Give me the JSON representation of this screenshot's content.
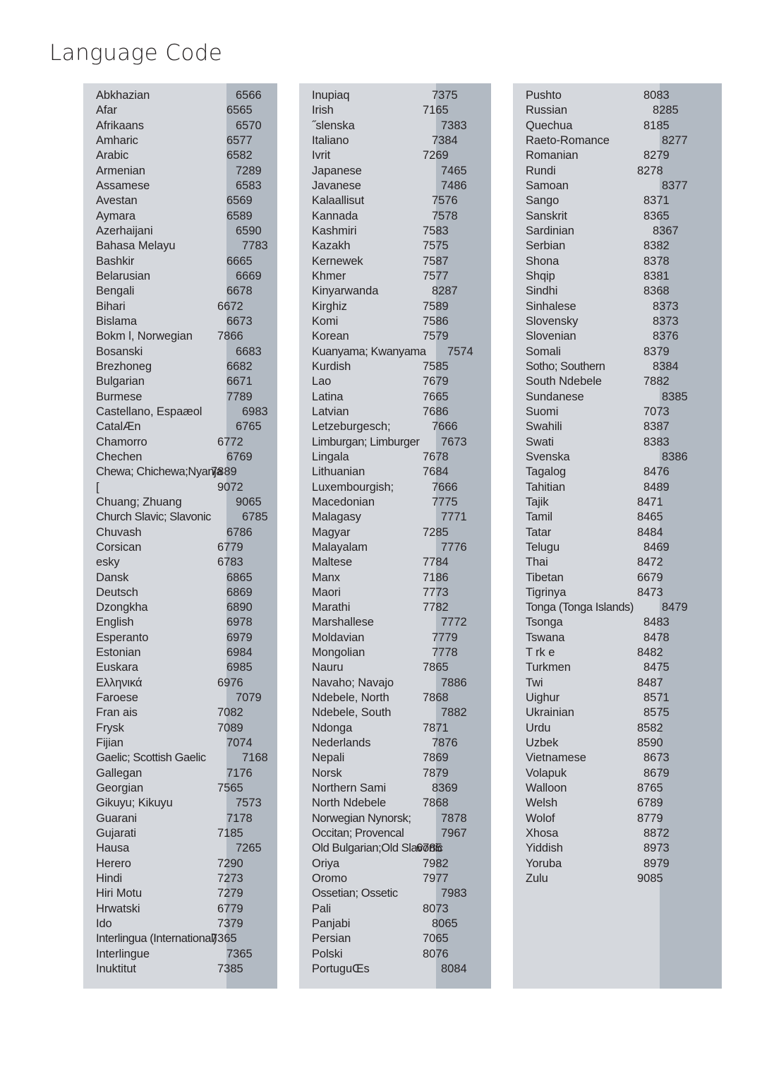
{
  "page": {
    "title": "Language Code"
  },
  "columns": [
    {
      "id": "column-1",
      "rows": [
        {
          "name": "Abkhazian",
          "code": "6566",
          "shift": "r"
        },
        {
          "name": "Afar",
          "code": "6565",
          "shift": ""
        },
        {
          "name": "Afrikaans",
          "code": "6570",
          "shift": "r"
        },
        {
          "name": "Amharic",
          "code": "6577",
          "shift": ""
        },
        {
          "name": "Arabic",
          "code": "6582",
          "shift": ""
        },
        {
          "name": "Armenian",
          "code": "7289",
          "shift": "r"
        },
        {
          "name": "Assamese",
          "code": "6583",
          "shift": "r"
        },
        {
          "name": "Avestan",
          "code": "6569",
          "shift": ""
        },
        {
          "name": "Aymara",
          "code": "6589",
          "shift": ""
        },
        {
          "name": "Azerhaijani",
          "code": "6590",
          "shift": "r"
        },
        {
          "name": "Bahasa Melayu",
          "code": "7783",
          "shift": "r2"
        },
        {
          "name": "Bashkir",
          "code": "6665",
          "shift": ""
        },
        {
          "name": "Belarusian",
          "code": "6669",
          "shift": "r"
        },
        {
          "name": "Bengali",
          "code": "6678",
          "shift": ""
        },
        {
          "name": "Bihari",
          "code": "6672",
          "shift": "l"
        },
        {
          "name": "Bislama",
          "code": "6673",
          "shift": ""
        },
        {
          "name": "Bokm l, Norwegian",
          "code": "7866",
          "shift": "l"
        },
        {
          "name": "Bosanski",
          "code": "6683",
          "shift": "r"
        },
        {
          "name": "Brezhoneg",
          "code": "6682",
          "shift": ""
        },
        {
          "name": "Bulgarian",
          "code": "6671",
          "shift": ""
        },
        {
          "name": "Burmese",
          "code": "7789",
          "shift": ""
        },
        {
          "name": "Castellano, Espaæol",
          "code": "6983",
          "shift": "r2"
        },
        {
          "name": "CatalÆn",
          "code": "6765",
          "shift": "r"
        },
        {
          "name": "Chamorro",
          "code": "6772",
          "shift": "l"
        },
        {
          "name": "Chechen",
          "code": "6769",
          "shift": ""
        },
        {
          "name": "Chewa; Chichewa;Nyanja",
          "code": "7889",
          "shift": "l2",
          "wide": true
        },
        {
          "name": "[",
          "code": "9072",
          "shift": "l"
        },
        {
          "name": "Chuang; Zhuang",
          "code": "9065",
          "shift": "r"
        },
        {
          "name": "Church Slavic; Slavonic",
          "code": "6785",
          "shift": "r2",
          "wide": true
        },
        {
          "name": "Chuvash",
          "code": "6786",
          "shift": ""
        },
        {
          "name": "Corsican",
          "code": "6779",
          "shift": "l"
        },
        {
          "name": " esky",
          "code": "6783",
          "shift": "l"
        },
        {
          "name": "Dansk",
          "code": "6865",
          "shift": ""
        },
        {
          "name": "Deutsch",
          "code": "6869",
          "shift": ""
        },
        {
          "name": "Dzongkha",
          "code": "6890",
          "shift": ""
        },
        {
          "name": "English",
          "code": "6978",
          "shift": ""
        },
        {
          "name": "Esperanto",
          "code": "6979",
          "shift": ""
        },
        {
          "name": "Estonian",
          "code": "6984",
          "shift": ""
        },
        {
          "name": "Euskara",
          "code": "6985",
          "shift": ""
        },
        {
          "name": "Ελληνικά",
          "code": "6976",
          "shift": "l"
        },
        {
          "name": "Faroese",
          "code": "7079",
          "shift": "r"
        },
        {
          "name": "Fran ais",
          "code": "7082",
          "shift": "l"
        },
        {
          "name": "Frysk",
          "code": "7089",
          "shift": "l"
        },
        {
          "name": "Fijian",
          "code": "7074",
          "shift": ""
        },
        {
          "name": "Gaelic; Scottish Gaelic",
          "code": "7168",
          "shift": "r2",
          "wide": true
        },
        {
          "name": "Gallegan",
          "code": "7176",
          "shift": ""
        },
        {
          "name": "Georgian",
          "code": "7565",
          "shift": "l"
        },
        {
          "name": "Gikuyu; Kikuyu",
          "code": "7573",
          "shift": "r"
        },
        {
          "name": "Guarani",
          "code": "7178",
          "shift": ""
        },
        {
          "name": "Gujarati",
          "code": "7185",
          "shift": "l"
        },
        {
          "name": "Hausa",
          "code": "7265",
          "shift": "r"
        },
        {
          "name": "Herero",
          "code": "7290",
          "shift": "l"
        },
        {
          "name": "Hindi",
          "code": "7273",
          "shift": "l"
        },
        {
          "name": "Hiri Motu",
          "code": "7279",
          "shift": "l"
        },
        {
          "name": "Hrwatski",
          "code": "6779",
          "shift": "l"
        },
        {
          "name": "Ido",
          "code": "7379",
          "shift": "l"
        },
        {
          "name": "Interlingua (International)",
          "code": "7365",
          "shift": "l2",
          "wide": true
        },
        {
          "name": "Interlingue",
          "code": "7365",
          "shift": ""
        },
        {
          "name": "Inuktitut",
          "code": "7385",
          "shift": "l"
        }
      ]
    },
    {
      "id": "column-2",
      "rows": [
        {
          "name": "Inupiaq",
          "code": "7375",
          "shift": ""
        },
        {
          "name": "Irish",
          "code": "7165",
          "shift": "l"
        },
        {
          "name": "˝slenska",
          "code": "7383",
          "shift": "r"
        },
        {
          "name": "Italiano",
          "code": "7384",
          "shift": ""
        },
        {
          "name": "Ivrit",
          "code": "7269",
          "shift": "l"
        },
        {
          "name": "Japanese",
          "code": "7465",
          "shift": "r"
        },
        {
          "name": "Javanese",
          "code": "7486",
          "shift": "r"
        },
        {
          "name": "Kalaallisut",
          "code": "7576",
          "shift": ""
        },
        {
          "name": "Kannada",
          "code": "7578",
          "shift": ""
        },
        {
          "name": "Kashmiri",
          "code": "7583",
          "shift": "l"
        },
        {
          "name": "Kazakh",
          "code": "7575",
          "shift": "l"
        },
        {
          "name": "Kernewek",
          "code": "7587",
          "shift": "l"
        },
        {
          "name": "Khmer",
          "code": "7577",
          "shift": "l"
        },
        {
          "name": "Kinyarwanda",
          "code": "8287",
          "shift": ""
        },
        {
          "name": "Kirghiz",
          "code": "7589",
          "shift": "l"
        },
        {
          "name": "Komi",
          "code": "7586",
          "shift": "l"
        },
        {
          "name": "Korean",
          "code": "7579",
          "shift": "l"
        },
        {
          "name": "Kuanyama; Kwanyama",
          "code": "7574",
          "shift": "r2",
          "wide": true
        },
        {
          "name": "Kurdish",
          "code": "7585",
          "shift": "l"
        },
        {
          "name": "Lao",
          "code": "7679",
          "shift": "l"
        },
        {
          "name": "Latina",
          "code": "7665",
          "shift": "l"
        },
        {
          "name": "Latvian",
          "code": "7686",
          "shift": "l"
        },
        {
          "name": "Letzeburgesch;",
          "code": "7666",
          "shift": ""
        },
        {
          "name": "Limburgan; Limburger",
          "code": "7673",
          "shift": "r",
          "wide": true
        },
        {
          "name": "Lingala",
          "code": "7678",
          "shift": "l"
        },
        {
          "name": "Lithuanian",
          "code": "7684",
          "shift": "l"
        },
        {
          "name": "Luxembourgish;",
          "code": "7666",
          "shift": ""
        },
        {
          "name": "Macedonian",
          "code": "7775",
          "shift": ""
        },
        {
          "name": "Malagasy",
          "code": "7771",
          "shift": "r"
        },
        {
          "name": "Magyar",
          "code": "7285",
          "shift": "l"
        },
        {
          "name": "Malayalam",
          "code": "7776",
          "shift": "r"
        },
        {
          "name": "Maltese",
          "code": "7784",
          "shift": "l"
        },
        {
          "name": "Manx",
          "code": "7186",
          "shift": "l"
        },
        {
          "name": "Maori",
          "code": "7773",
          "shift": "l"
        },
        {
          "name": "Marathi",
          "code": "7782",
          "shift": "l"
        },
        {
          "name": "Marshallese",
          "code": "7772",
          "shift": "r"
        },
        {
          "name": "Moldavian",
          "code": "7779",
          "shift": ""
        },
        {
          "name": "Mongolian",
          "code": "7778",
          "shift": ""
        },
        {
          "name": "Nauru",
          "code": "7865",
          "shift": "l"
        },
        {
          "name": "Navaho; Navajo",
          "code": "7886",
          "shift": "r"
        },
        {
          "name": "Ndebele, North",
          "code": "7868",
          "shift": "l"
        },
        {
          "name": "Ndebele, South",
          "code": "7882",
          "shift": "r"
        },
        {
          "name": "Ndonga",
          "code": "7871",
          "shift": "l"
        },
        {
          "name": "Nederlands",
          "code": "7876",
          "shift": ""
        },
        {
          "name": "Nepali",
          "code": "7869",
          "shift": "l"
        },
        {
          "name": "Norsk",
          "code": "7879",
          "shift": "l"
        },
        {
          "name": "Northern Sami",
          "code": "8369",
          "shift": ""
        },
        {
          "name": "North Ndebele",
          "code": "7868",
          "shift": "l"
        },
        {
          "name": "Norwegian Nynorsk;",
          "code": "7878",
          "shift": "r",
          "wide": true
        },
        {
          "name": "Occitan; Provencal",
          "code": "7967",
          "shift": "r",
          "wide": true
        },
        {
          "name": "Old Bulgarian;Old Slavonic",
          "code": "6785",
          "shift": "l2",
          "wide": true
        },
        {
          "name": "Oriya",
          "code": "7982",
          "shift": "l"
        },
        {
          "name": "Oromo",
          "code": "7977",
          "shift": "l"
        },
        {
          "name": "Ossetian; Ossetic",
          "code": "7983",
          "shift": "r",
          "wide": true
        },
        {
          "name": "Pali",
          "code": "8073",
          "shift": "l"
        },
        {
          "name": "Panjabi",
          "code": "8065",
          "shift": ""
        },
        {
          "name": "Persian",
          "code": "7065",
          "shift": "l"
        },
        {
          "name": "Polski",
          "code": "8076",
          "shift": "l"
        },
        {
          "name": "PortuguŒs",
          "code": "8084",
          "shift": "r"
        }
      ]
    },
    {
      "id": "column-3",
      "rows": [
        {
          "name": "Pushto",
          "code": "8083",
          "shift": "l"
        },
        {
          "name": "Russian",
          "code": "8285",
          "shift": ""
        },
        {
          "name": "Quechua",
          "code": "8185",
          "shift": "l"
        },
        {
          "name": "Raeto-Romance",
          "code": "8277",
          "shift": "r"
        },
        {
          "name": "Romanian",
          "code": "8279",
          "shift": "l"
        },
        {
          "name": "Rundi",
          "code": "8278",
          "shift": "l2"
        },
        {
          "name": "Samoan",
          "code": "8377",
          "shift": "r"
        },
        {
          "name": "Sango",
          "code": "8371",
          "shift": "l"
        },
        {
          "name": "Sanskrit",
          "code": "8365",
          "shift": "l"
        },
        {
          "name": "Sardinian",
          "code": "8367",
          "shift": ""
        },
        {
          "name": "Serbian",
          "code": "8382",
          "shift": "l"
        },
        {
          "name": "Shona",
          "code": "8378",
          "shift": "l"
        },
        {
          "name": "Shqip",
          "code": "8381",
          "shift": "l"
        },
        {
          "name": "Sindhi",
          "code": "8368",
          "shift": "l"
        },
        {
          "name": "Sinhalese",
          "code": "8373",
          "shift": ""
        },
        {
          "name": "Slovensky",
          "code": "8373",
          "shift": ""
        },
        {
          "name": "Slovenian",
          "code": "8376",
          "shift": ""
        },
        {
          "name": "Somali",
          "code": "8379",
          "shift": "l"
        },
        {
          "name": "Sotho; Southern",
          "code": "8384",
          "shift": "",
          "wide": true
        },
        {
          "name": "South Ndebele",
          "code": "7882",
          "shift": "l"
        },
        {
          "name": "Sundanese",
          "code": "8385",
          "shift": "r"
        },
        {
          "name": "Suomi",
          "code": "7073",
          "shift": "l"
        },
        {
          "name": "Swahili",
          "code": "8387",
          "shift": "l"
        },
        {
          "name": "Swati",
          "code": "8383",
          "shift": "l"
        },
        {
          "name": "Svenska",
          "code": "8386",
          "shift": "r"
        },
        {
          "name": "Tagalog",
          "code": "8476",
          "shift": "l"
        },
        {
          "name": "Tahitian",
          "code": "8489",
          "shift": "l"
        },
        {
          "name": "Tajik",
          "code": "8471",
          "shift": "l2"
        },
        {
          "name": "Tamil",
          "code": "8465",
          "shift": "l2"
        },
        {
          "name": "Tatar",
          "code": "8484",
          "shift": "l2"
        },
        {
          "name": "Telugu",
          "code": "8469",
          "shift": "l"
        },
        {
          "name": "Thai",
          "code": "8472",
          "shift": "l2"
        },
        {
          "name": "Tibetan",
          "code": "6679",
          "shift": "l2"
        },
        {
          "name": "Tigrinya",
          "code": "8473",
          "shift": "l2"
        },
        {
          "name": "Tonga (Tonga Islands)",
          "code": "8479",
          "shift": "r",
          "wide": true
        },
        {
          "name": "Tsonga",
          "code": "8483",
          "shift": "l"
        },
        {
          "name": "Tswana",
          "code": "8478",
          "shift": "l"
        },
        {
          "name": "T rk e",
          "code": "8482",
          "shift": "l2"
        },
        {
          "name": "Turkmen",
          "code": "8475",
          "shift": "l"
        },
        {
          "name": "Twi",
          "code": "8487",
          "shift": "l2"
        },
        {
          "name": "Uighur",
          "code": "8571",
          "shift": "l"
        },
        {
          "name": "Ukrainian",
          "code": "8575",
          "shift": "l"
        },
        {
          "name": "Urdu",
          "code": "8582",
          "shift": "l2"
        },
        {
          "name": "Uzbek",
          "code": "8590",
          "shift": "l2"
        },
        {
          "name": "Vietnamese",
          "code": "8673",
          "shift": "l"
        },
        {
          "name": "Volapuk",
          "code": "8679",
          "shift": "l"
        },
        {
          "name": "Walloon",
          "code": "8765",
          "shift": "l2"
        },
        {
          "name": "Welsh",
          "code": "6789",
          "shift": "l2"
        },
        {
          "name": "Wolof",
          "code": "8779",
          "shift": "l2"
        },
        {
          "name": "Xhosa",
          "code": "8872",
          "shift": "l"
        },
        {
          "name": "Yiddish",
          "code": "8973",
          "shift": "l"
        },
        {
          "name": "Yoruba",
          "code": "8979",
          "shift": "l"
        },
        {
          "name": "Zulu",
          "code": "9085",
          "shift": "l2"
        }
      ]
    }
  ]
}
